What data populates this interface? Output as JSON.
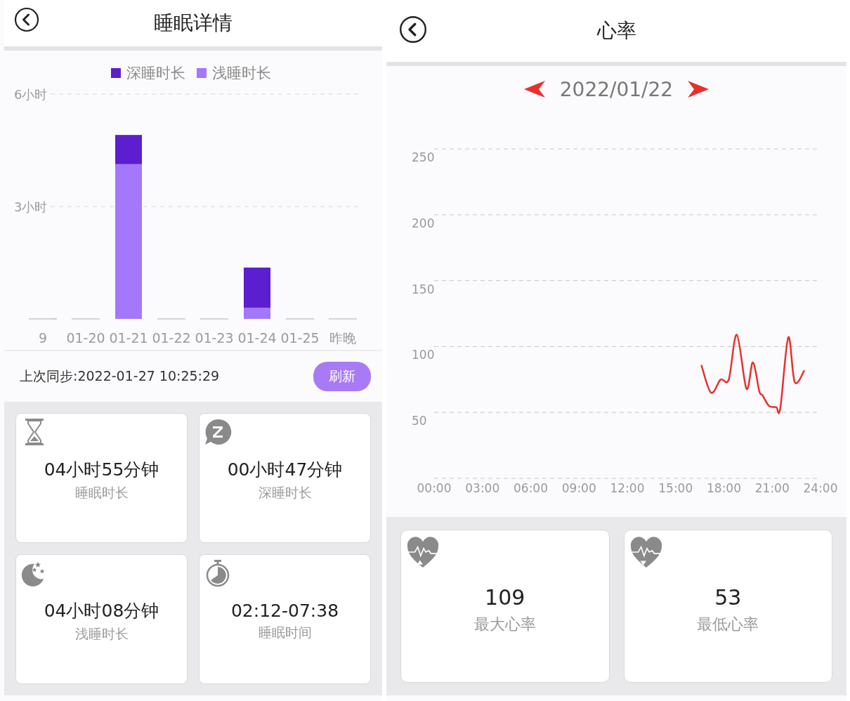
{
  "sleep_screen": {
    "title": "睡眠详情",
    "chart_data": {
      "type": "bar",
      "stacked": true,
      "legend": "top",
      "categories": [
        "9",
        "01-20",
        "01-21",
        "01-22",
        "01-23",
        "01-24",
        "01-25",
        "昨晚"
      ],
      "ylim": [
        0,
        6
      ],
      "yticks": [
        {
          "value": 3,
          "label": "3小时"
        },
        {
          "value": 6,
          "label": "6小时"
        }
      ],
      "series": [
        {
          "name": "浅睡时长",
          "color": "#a478fa",
          "values": [
            0,
            0,
            4.13,
            0,
            0,
            0.3,
            0,
            0
          ]
        },
        {
          "name": "深睡时长",
          "color": "#5b1fcf",
          "values": [
            0,
            0,
            0.78,
            0,
            0,
            1.07,
            0,
            0
          ]
        }
      ]
    },
    "last_sync": "上次同步:2022-01-27 10:25:29",
    "refresh_button": "刷新",
    "cards": [
      {
        "kind": "hourglass",
        "value": "04小时55分钟",
        "label": "睡眠时长"
      },
      {
        "kind": "sleep",
        "value": "00小时47分钟",
        "label": "深睡时长"
      },
      {
        "kind": "moon",
        "value": "04小时08分钟",
        "label": "浅睡时长"
      },
      {
        "kind": "timer",
        "value": "02:12-07:38",
        "label": "睡眠时间"
      }
    ]
  },
  "heart_screen": {
    "title": "心率",
    "date": "2022/01/22",
    "chart_data": {
      "type": "line",
      "grid": true,
      "xlim": [
        0,
        24
      ],
      "ylim": [
        0,
        250
      ],
      "yticks": [
        50,
        100,
        150,
        200,
        250
      ],
      "xticks": [
        {
          "value": 0,
          "label": "00:00"
        },
        {
          "value": 3,
          "label": "03:00"
        },
        {
          "value": 6,
          "label": "06:00"
        },
        {
          "value": 9,
          "label": "09:00"
        },
        {
          "value": 12,
          "label": "12:00"
        },
        {
          "value": 15,
          "label": "15:00"
        },
        {
          "value": 18,
          "label": "18:00"
        },
        {
          "value": 21,
          "label": "21:00"
        },
        {
          "value": 24,
          "label": "24:00"
        }
      ],
      "x": [
        16.6,
        17.2,
        17.8,
        18.3,
        18.8,
        19.4,
        19.8,
        20.2,
        20.4,
        20.8,
        21.25,
        21.5,
        22.0,
        22.4,
        23.0
      ],
      "series": [
        {
          "color": "#e8302a",
          "values": [
            86,
            65,
            75,
            75,
            109,
            68,
            88,
            66,
            63,
            55,
            54,
            53,
            107,
            73,
            82
          ]
        }
      ]
    },
    "cards": [
      {
        "kind": "max",
        "value": "109",
        "label": "最大心率"
      },
      {
        "kind": "min",
        "value": "53",
        "label": "最低心率"
      }
    ]
  }
}
